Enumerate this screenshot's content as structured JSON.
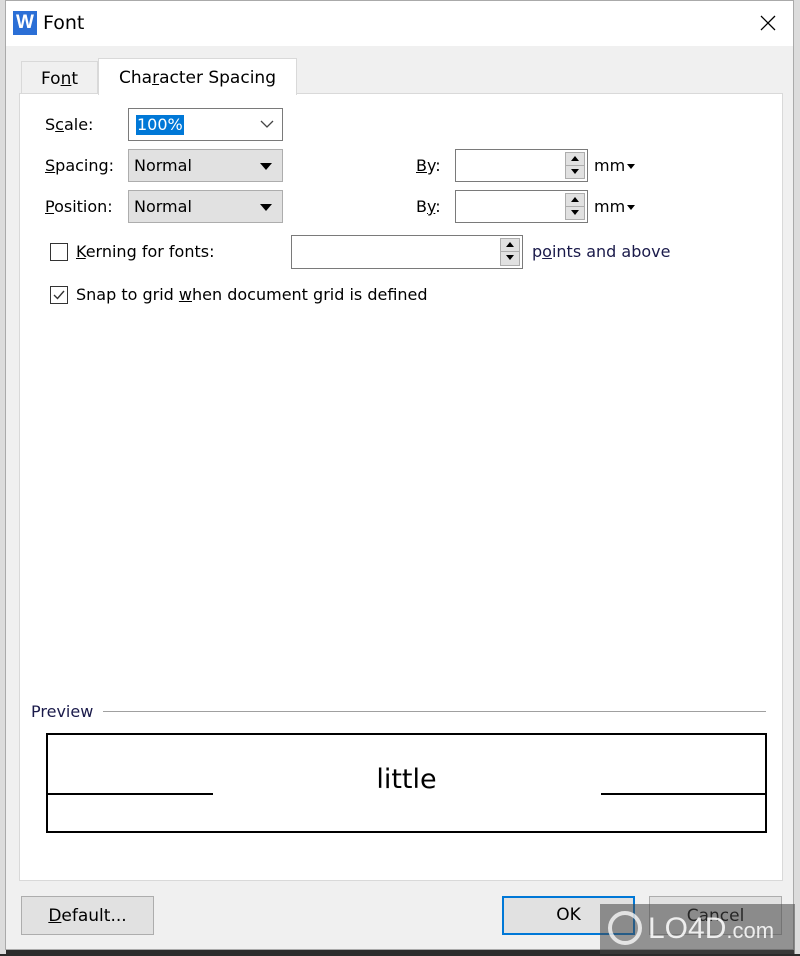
{
  "window": {
    "title": "Font",
    "app_icon": "W",
    "close_label": "×"
  },
  "tabs": [
    {
      "label_pre": "Fo",
      "label_u": "n",
      "label_post": "t",
      "active": false
    },
    {
      "label_pre": "Cha",
      "label_u": "r",
      "label_post": "acter Spacing",
      "active": true
    }
  ],
  "scale": {
    "label_pre": "S",
    "label_u": "c",
    "label_post": "ale:",
    "value": "100%"
  },
  "spacing": {
    "label_pre": "",
    "label_u": "S",
    "label_post": "pacing:",
    "value": "Normal",
    "by_label_pre": "",
    "by_label_u": "B",
    "by_label_post": "y:",
    "by_value": "",
    "unit": "mm"
  },
  "position": {
    "label_pre": "",
    "label_u": "P",
    "label_post": "osition:",
    "value": "Normal",
    "by_label_pre": "B",
    "by_label_u": "y",
    "by_label_post": ":",
    "by_value": "",
    "unit": "mm"
  },
  "kerning": {
    "checked": false,
    "label_pre": "",
    "label_u": "K",
    "label_post": "erning for fonts:",
    "value": "",
    "suffix_pre": "p",
    "suffix_u": "o",
    "suffix_post": "ints and above"
  },
  "snap": {
    "checked": true,
    "label_pre": "Snap to grid ",
    "label_u": "w",
    "label_post": "hen document grid is defined"
  },
  "preview": {
    "label": "Preview",
    "sample_text": "little"
  },
  "buttons": {
    "default_pre": "",
    "default_u": "D",
    "default_post": "efault...",
    "ok": "OK",
    "cancel": "Cancel"
  },
  "watermark": {
    "text": "LO4D",
    "suffix": ".com"
  }
}
